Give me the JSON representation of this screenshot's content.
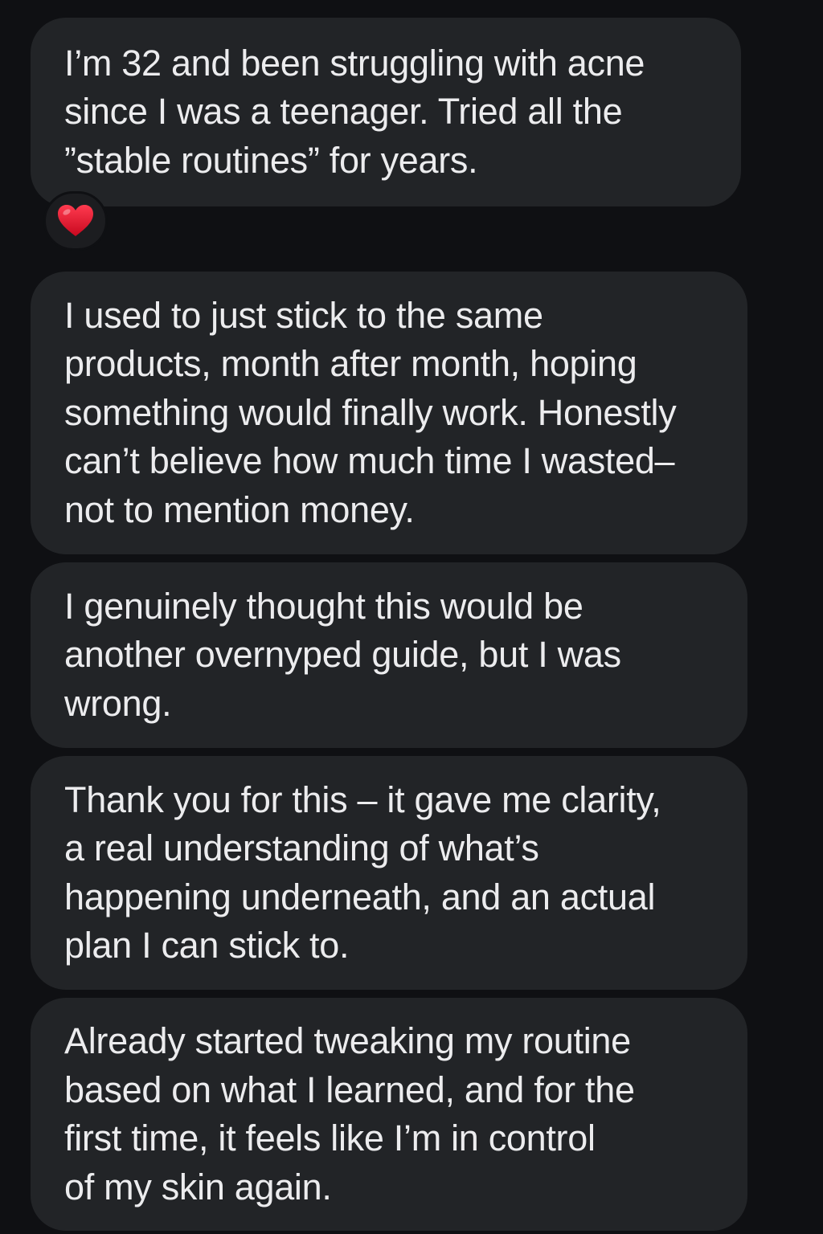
{
  "colors": {
    "background": "#0f1013",
    "bubble": "#222427",
    "text": "#ececee",
    "reaction_heart": "#e0102b"
  },
  "messages": [
    {
      "text": "I’m 32 and been struggling with acne\nsince I was a teenager. Tried all the\n”stable routines” for years.",
      "reaction": "heart-icon"
    },
    {
      "text": "I used to just stick to the same\nproducts, month after month, hoping\nsomething would finally work. Honestly\ncan’t believe how much time I wasted–\nnot to mention money."
    },
    {
      "text": "I genuinely thought this would be\nanother overnyped guide, but I was\nwrong."
    },
    {
      "text": "Thank you for this – it gave me clarity,\na real understanding of what’s\nhappening underneath, and an actual\nplan I can stick to."
    },
    {
      "text": "Already started tweaking my routine\nbased on what I learned, and for the\nfirst time, it feels like I’m in control\nof my skin again."
    }
  ]
}
